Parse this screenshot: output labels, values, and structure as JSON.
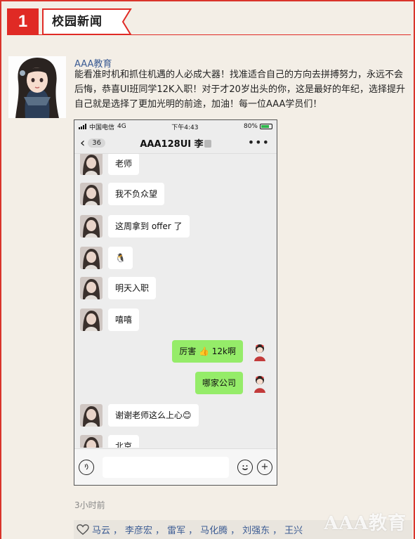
{
  "banner": {
    "number": "1",
    "title": "校园新闻"
  },
  "post": {
    "author": "AAA教育",
    "text": "能看准时机和抓住机遇的人必成大器！找准适合自己的方向去拼搏努力，永远不会后悔，恭喜UI班同学12K入职！对于才20岁出头的你，这是最好的年纪，选择提升自己就是选择了更加光明的前途，加油！每一位AAA学员们！",
    "time_ago": "3小时前"
  },
  "phone": {
    "carrier": "中国电信",
    "network": "4G",
    "time": "下午4:43",
    "battery": "80%",
    "battery_level": 0.8,
    "unread_count": "36",
    "chat_title": "AAA128UI 李",
    "messages": [
      {
        "side": "in",
        "text": "老师"
      },
      {
        "side": "in",
        "text": "我不负众望"
      },
      {
        "side": "in",
        "text": "这周拿到 offer 了"
      },
      {
        "side": "in",
        "text": "🐧"
      },
      {
        "side": "in",
        "text": "明天入职"
      },
      {
        "side": "in",
        "text": "嘻嘻"
      },
      {
        "side": "out",
        "text": "厉害 👍 12k啊"
      },
      {
        "side": "out",
        "text": "哪家公司"
      },
      {
        "side": "in",
        "text": "谢谢老师这么上心😊"
      },
      {
        "side": "in",
        "text": "北京"
      }
    ]
  },
  "likes": {
    "names": [
      "马云",
      "李彦宏",
      "雷军",
      "马化腾",
      "刘强东",
      "王兴"
    ],
    "separator": "，"
  },
  "watermark": "AAA教育",
  "icons": {
    "heart": "heart-icon",
    "back": "chevron-left-icon",
    "more": "more-dots-icon",
    "voice": "voice-icon",
    "emoji": "emoji-icon",
    "add": "plus-icon"
  },
  "colors": {
    "accent_red": "#e02a25",
    "link_blue": "#3b5b93",
    "bubble_green": "#95ec69"
  }
}
